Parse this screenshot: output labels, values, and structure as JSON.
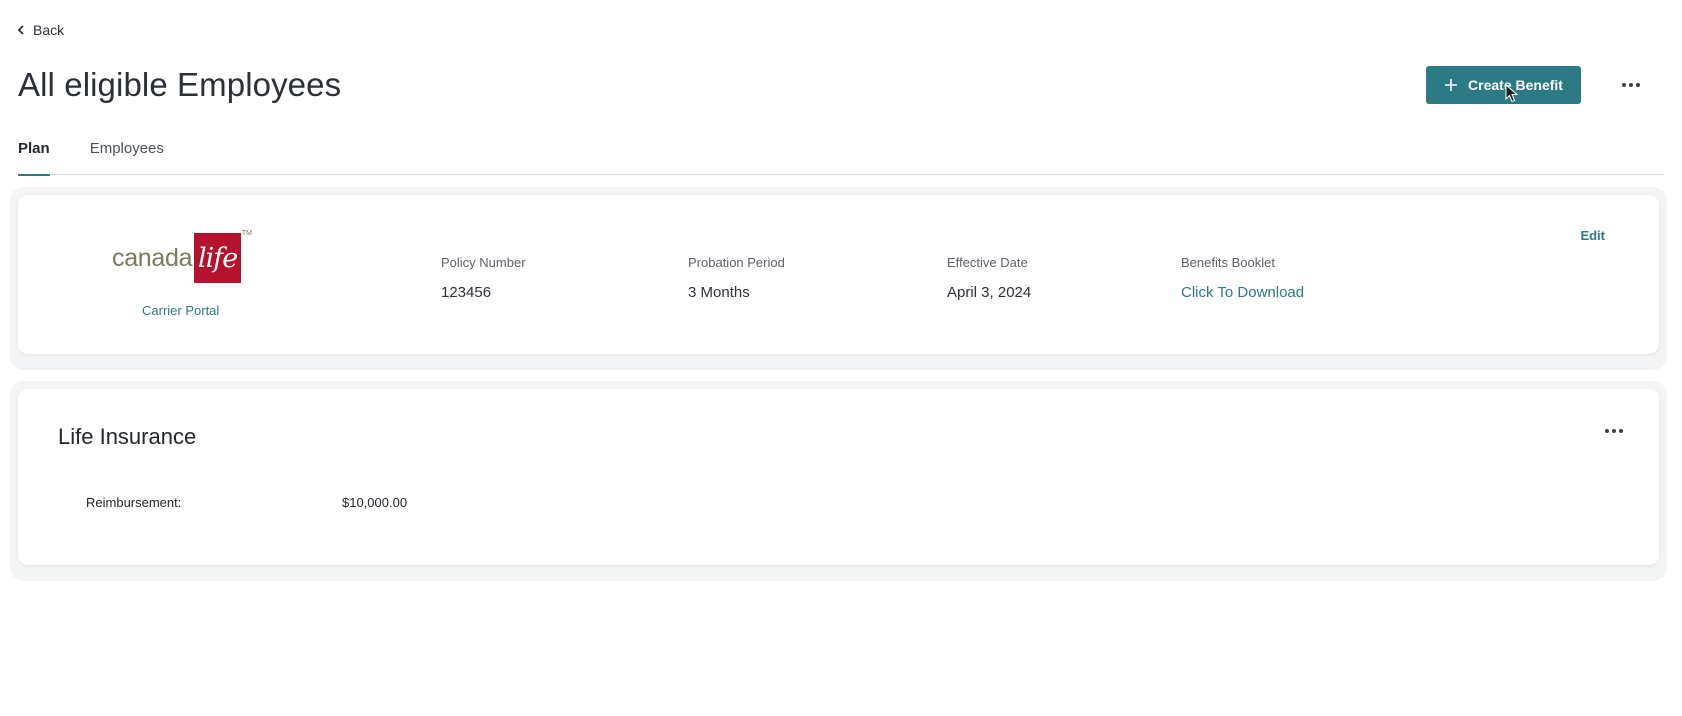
{
  "nav": {
    "back_label": "Back"
  },
  "header": {
    "title": "All eligible Employees",
    "create_label": "Create Benefit"
  },
  "tabs": [
    {
      "label": "Plan",
      "active": true
    },
    {
      "label": "Employees",
      "active": false
    }
  ],
  "plan": {
    "carrier_logo": {
      "word": "canada",
      "box": "life",
      "tm": "TM"
    },
    "carrier_portal_label": "Carrier Portal",
    "edit_label": "Edit",
    "fields": {
      "policy_number": {
        "label": "Policy Number",
        "value": "123456"
      },
      "probation_period": {
        "label": "Probation Period",
        "value": "3 Months"
      },
      "effective_date": {
        "label": "Effective Date",
        "value": "April 3, 2024"
      },
      "benefits_booklet": {
        "label": "Benefits Booklet",
        "value": "Click To Download"
      }
    }
  },
  "life_insurance": {
    "title": "Life Insurance",
    "reimbursement_label": "Reimbursement:",
    "reimbursement_value": "$10,000.00"
  },
  "colors": {
    "accent": "#2b7a85",
    "logo_red": "#b5122e",
    "logo_olive": "#7d7a5b"
  },
  "icons": {
    "back": "chevron-left-icon",
    "create": "plus-icon",
    "more": "more-horizontal-icon"
  }
}
